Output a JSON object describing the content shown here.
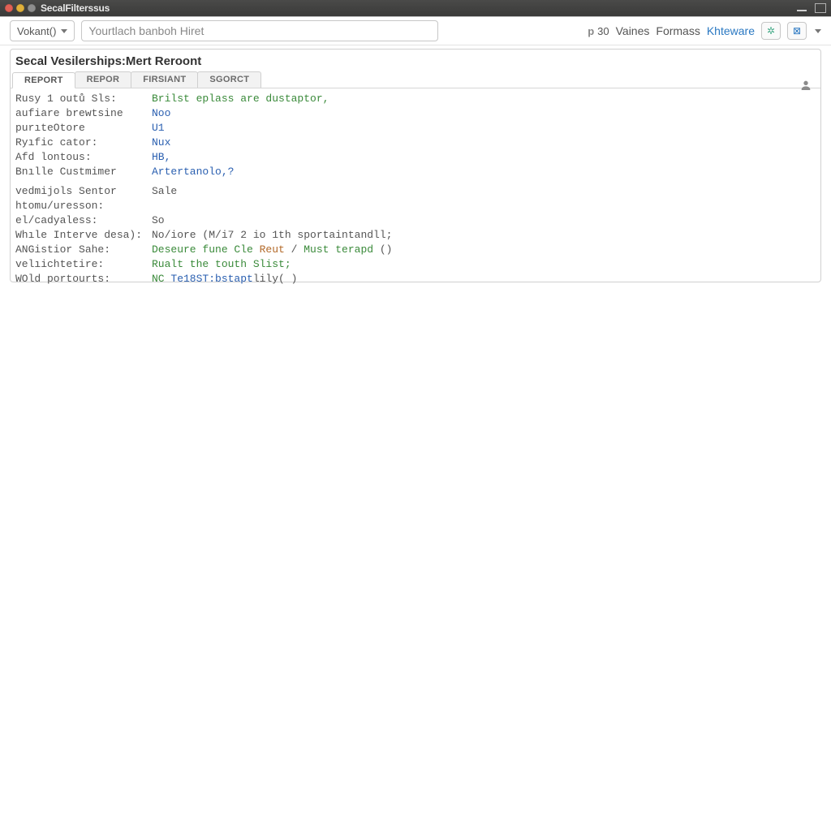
{
  "window": {
    "title": "SecalFilterssus"
  },
  "toolbar": {
    "combo_label": "Vokant()",
    "search_placeholder": "Yourtlach banboh Hiret",
    "badge_prefix": "p",
    "badge_number": "30",
    "link_values": "Vaines",
    "link_formats": "Formass",
    "link_kiteware": "Khteware"
  },
  "card": {
    "title": "Secal Vesilerships:Mert Reroont",
    "tabs": [
      "REPORT",
      "REPOR",
      "FIRSIANT",
      "SGORCT"
    ],
    "rows": [
      {
        "key": "Rusy 1 outů Sls:",
        "segments": [
          {
            "t": "Brilst eplass are dustaptor,",
            "c": "green"
          }
        ]
      },
      {
        "key": "aufiare brewtsine",
        "segments": [
          {
            "t": "Noo",
            "c": "blue"
          }
        ]
      },
      {
        "key": "purıteOtore",
        "segments": [
          {
            "t": "U1",
            "c": "blue"
          }
        ]
      },
      {
        "key": "Ryıfic cator:",
        "segments": [
          {
            "t": "Nux",
            "c": "blue"
          }
        ]
      },
      {
        "key": "Afd lontous:",
        "segments": [
          {
            "t": "HB,",
            "c": "blue"
          }
        ]
      },
      {
        "key": "Bnılle Custmimer",
        "segments": [
          {
            "t": "Artertanolo,?",
            "c": "blue"
          }
        ]
      },
      {
        "key": "",
        "segments": [],
        "spacer": true
      },
      {
        "key": "vedmijols Sentor",
        "segments": [
          {
            "t": "Sale",
            "c": "gray"
          }
        ]
      },
      {
        "key": "htomu/uresson:",
        "segments": []
      },
      {
        "key": "el/cadyaless:",
        "segments": [
          {
            "t": "So",
            "c": "gray"
          }
        ]
      },
      {
        "key": "Whıle Interve desa):",
        "segments": [
          {
            "t": "No/iore (M/i7 2 io 1th sportaintandll;",
            "c": "gray"
          }
        ]
      },
      {
        "key": "ANGistior Sahe:",
        "segments": [
          {
            "t": "Deseure fune Cle ",
            "c": "green"
          },
          {
            "t": "Reut",
            "c": "orange"
          },
          {
            "t": " / ",
            "c": "gray"
          },
          {
            "t": "Must terapd",
            "c": "green"
          },
          {
            "t": " ()",
            "c": "gray"
          }
        ]
      },
      {
        "key": "velıichtetire:",
        "segments": [
          {
            "t": "Rualt the touth Slist;",
            "c": "green"
          }
        ]
      },
      {
        "key": "WOld portourts:",
        "segments": [
          {
            "t": "NC ",
            "c": "green"
          },
          {
            "t": "Te18ST:bstapt",
            "c": "blue"
          },
          {
            "t": "lily( )",
            "c": "gray"
          }
        ]
      }
    ]
  }
}
